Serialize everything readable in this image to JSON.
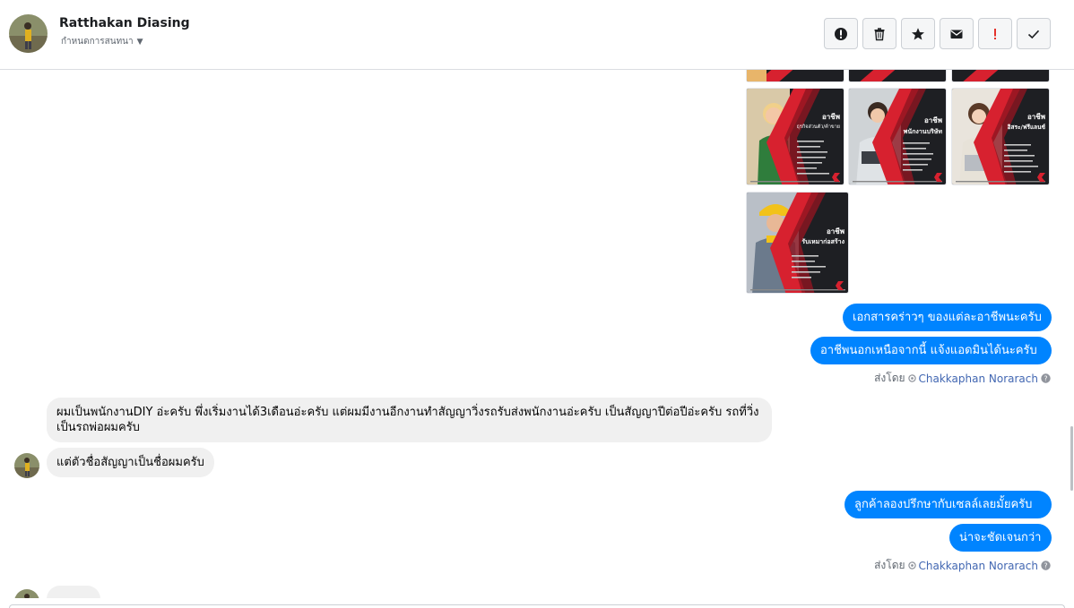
{
  "header": {
    "contact_name": "Ratthakan Diasing",
    "contact_sub": "กำหนดการสนทนา",
    "toolbar": [
      {
        "name": "info-button",
        "icon": "alert-circle-icon"
      },
      {
        "name": "delete-button",
        "icon": "trash-icon"
      },
      {
        "name": "star-button",
        "icon": "star-icon"
      },
      {
        "name": "mark-unread-button",
        "icon": "envelope-icon"
      },
      {
        "name": "spam-button",
        "icon": "exclamation-icon"
      },
      {
        "name": "done-button",
        "icon": "check-icon"
      }
    ]
  },
  "image_cards": [
    {
      "title": "อาชีพ",
      "subtitle": "ธุรกิจส่วนตัว/ค้าขาย",
      "accent": "#d7212f",
      "shirt": "#2f7d3c"
    },
    {
      "title": "อาชีพ",
      "subtitle": "พนักงานบริษัท",
      "accent": "#d7212f",
      "shirt": "#dfe3e6"
    },
    {
      "title": "อาชีพ",
      "subtitle": "อิสระ/ฟรีแลนซ์",
      "accent": "#d7212f",
      "shirt": "#e7e2d8"
    },
    {
      "title": "อาชีพ",
      "subtitle": "รับเหมาก่อสร้าง",
      "accent": "#d7212f",
      "shirt": "#6b7a8c"
    }
  ],
  "messages": {
    "out_1": "เอกสารคร่าวๆ ของแต่ละอาชีพนะครับ",
    "out_2": "อาชีพนอกเหนือจากนี้ แจ้งแอดมินได้นะครับ",
    "sent_by_label_1": "ส่งโดย",
    "agent_1": "Chakkaphan Norarach",
    "in_1": "ผมเป็นพนักงานDIY อ่ะครับ พึ่งเริ่มงานได้3เดือนอ่ะครับ แต่ผมมีงานอีกงานทำสัญญาวิ่งรถรับส่งพนักงานอ่ะครับ เป็นสัญญาปีต่อปีอ่ะครับ รถที่วิ่งเป็นรถพ่อผมครับ",
    "in_2": "แต่ตัวชื่อสัญญาเป็นชื่อผมครับ",
    "out_3": "ลูกค้าลองปรึกษากับเซลล์เลยมั้ยครับ",
    "out_4": "น่าจะชัดเจนกว่า",
    "sent_by_label_2": "ส่งโดย",
    "agent_2": "Chakkaphan Norarach"
  },
  "colors": {
    "outgoing_bubble": "#0084ff",
    "incoming_bubble": "#f0f0f0",
    "agent_link": "#4267b2",
    "card_accent": "#d7212f"
  }
}
